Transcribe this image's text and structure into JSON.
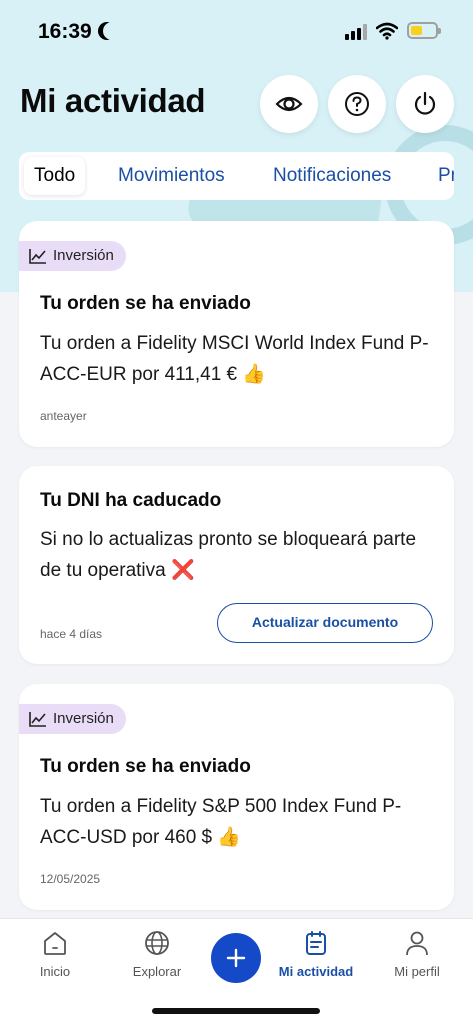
{
  "status_bar": {
    "time": "16:39"
  },
  "header": {
    "title": "Mi actividad"
  },
  "tabs": [
    {
      "label": "Todo"
    },
    {
      "label": "Movimientos"
    },
    {
      "label": "Notificaciones"
    },
    {
      "label": "Pr"
    }
  ],
  "cards": [
    {
      "badge": "Inversión",
      "title": "Tu orden se ha enviado",
      "body": "Tu orden a Fidelity MSCI World Index Fund P-ACC-EUR por 411,41 €",
      "emoji": "👍",
      "date": "anteayer"
    },
    {
      "title": "Tu DNI ha caducado",
      "body": "Si no lo actualizas pronto se bloqueará parte de tu operativa",
      "emoji": "❌",
      "date": "hace 4 días",
      "action": "Actualizar documento"
    },
    {
      "badge": "Inversión",
      "title": "Tu orden se ha enviado",
      "body": "Tu orden a Fidelity S&P 500 Index Fund P-ACC-USD por 460 $",
      "emoji": "👍",
      "date": "12/05/2025"
    }
  ],
  "bottom_nav": {
    "items": [
      {
        "label": "Inicio",
        "icon": "home-icon"
      },
      {
        "label": "Explorar",
        "icon": "globe-icon"
      },
      {
        "label": "Mi actividad",
        "icon": "activity-icon"
      },
      {
        "label": "Mi perfil",
        "icon": "profile-icon"
      }
    ],
    "fab_icon": "plus-icon"
  },
  "colors": {
    "accent": "#1a4fa6",
    "fab": "#1449c7",
    "hero": "#d7f1f7",
    "badge": "#e9dcf6"
  }
}
